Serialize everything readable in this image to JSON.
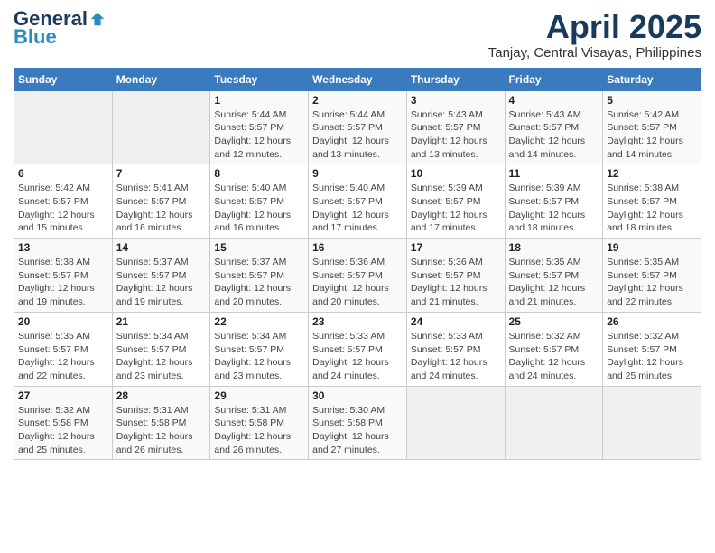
{
  "header": {
    "logo_general": "General",
    "logo_blue": "Blue",
    "month_title": "April 2025",
    "location": "Tanjay, Central Visayas, Philippines"
  },
  "calendar": {
    "days_of_week": [
      "Sunday",
      "Monday",
      "Tuesday",
      "Wednesday",
      "Thursday",
      "Friday",
      "Saturday"
    ],
    "weeks": [
      [
        {
          "day": "",
          "info": ""
        },
        {
          "day": "",
          "info": ""
        },
        {
          "day": "1",
          "info": "Sunrise: 5:44 AM\nSunset: 5:57 PM\nDaylight: 12 hours and 12 minutes."
        },
        {
          "day": "2",
          "info": "Sunrise: 5:44 AM\nSunset: 5:57 PM\nDaylight: 12 hours and 13 minutes."
        },
        {
          "day": "3",
          "info": "Sunrise: 5:43 AM\nSunset: 5:57 PM\nDaylight: 12 hours and 13 minutes."
        },
        {
          "day": "4",
          "info": "Sunrise: 5:43 AM\nSunset: 5:57 PM\nDaylight: 12 hours and 14 minutes."
        },
        {
          "day": "5",
          "info": "Sunrise: 5:42 AM\nSunset: 5:57 PM\nDaylight: 12 hours and 14 minutes."
        }
      ],
      [
        {
          "day": "6",
          "info": "Sunrise: 5:42 AM\nSunset: 5:57 PM\nDaylight: 12 hours and 15 minutes."
        },
        {
          "day": "7",
          "info": "Sunrise: 5:41 AM\nSunset: 5:57 PM\nDaylight: 12 hours and 16 minutes."
        },
        {
          "day": "8",
          "info": "Sunrise: 5:40 AM\nSunset: 5:57 PM\nDaylight: 12 hours and 16 minutes."
        },
        {
          "day": "9",
          "info": "Sunrise: 5:40 AM\nSunset: 5:57 PM\nDaylight: 12 hours and 17 minutes."
        },
        {
          "day": "10",
          "info": "Sunrise: 5:39 AM\nSunset: 5:57 PM\nDaylight: 12 hours and 17 minutes."
        },
        {
          "day": "11",
          "info": "Sunrise: 5:39 AM\nSunset: 5:57 PM\nDaylight: 12 hours and 18 minutes."
        },
        {
          "day": "12",
          "info": "Sunrise: 5:38 AM\nSunset: 5:57 PM\nDaylight: 12 hours and 18 minutes."
        }
      ],
      [
        {
          "day": "13",
          "info": "Sunrise: 5:38 AM\nSunset: 5:57 PM\nDaylight: 12 hours and 19 minutes."
        },
        {
          "day": "14",
          "info": "Sunrise: 5:37 AM\nSunset: 5:57 PM\nDaylight: 12 hours and 19 minutes."
        },
        {
          "day": "15",
          "info": "Sunrise: 5:37 AM\nSunset: 5:57 PM\nDaylight: 12 hours and 20 minutes."
        },
        {
          "day": "16",
          "info": "Sunrise: 5:36 AM\nSunset: 5:57 PM\nDaylight: 12 hours and 20 minutes."
        },
        {
          "day": "17",
          "info": "Sunrise: 5:36 AM\nSunset: 5:57 PM\nDaylight: 12 hours and 21 minutes."
        },
        {
          "day": "18",
          "info": "Sunrise: 5:35 AM\nSunset: 5:57 PM\nDaylight: 12 hours and 21 minutes."
        },
        {
          "day": "19",
          "info": "Sunrise: 5:35 AM\nSunset: 5:57 PM\nDaylight: 12 hours and 22 minutes."
        }
      ],
      [
        {
          "day": "20",
          "info": "Sunrise: 5:35 AM\nSunset: 5:57 PM\nDaylight: 12 hours and 22 minutes."
        },
        {
          "day": "21",
          "info": "Sunrise: 5:34 AM\nSunset: 5:57 PM\nDaylight: 12 hours and 23 minutes."
        },
        {
          "day": "22",
          "info": "Sunrise: 5:34 AM\nSunset: 5:57 PM\nDaylight: 12 hours and 23 minutes."
        },
        {
          "day": "23",
          "info": "Sunrise: 5:33 AM\nSunset: 5:57 PM\nDaylight: 12 hours and 24 minutes."
        },
        {
          "day": "24",
          "info": "Sunrise: 5:33 AM\nSunset: 5:57 PM\nDaylight: 12 hours and 24 minutes."
        },
        {
          "day": "25",
          "info": "Sunrise: 5:32 AM\nSunset: 5:57 PM\nDaylight: 12 hours and 24 minutes."
        },
        {
          "day": "26",
          "info": "Sunrise: 5:32 AM\nSunset: 5:57 PM\nDaylight: 12 hours and 25 minutes."
        }
      ],
      [
        {
          "day": "27",
          "info": "Sunrise: 5:32 AM\nSunset: 5:58 PM\nDaylight: 12 hours and 25 minutes."
        },
        {
          "day": "28",
          "info": "Sunrise: 5:31 AM\nSunset: 5:58 PM\nDaylight: 12 hours and 26 minutes."
        },
        {
          "day": "29",
          "info": "Sunrise: 5:31 AM\nSunset: 5:58 PM\nDaylight: 12 hours and 26 minutes."
        },
        {
          "day": "30",
          "info": "Sunrise: 5:30 AM\nSunset: 5:58 PM\nDaylight: 12 hours and 27 minutes."
        },
        {
          "day": "",
          "info": ""
        },
        {
          "day": "",
          "info": ""
        },
        {
          "day": "",
          "info": ""
        }
      ]
    ]
  }
}
